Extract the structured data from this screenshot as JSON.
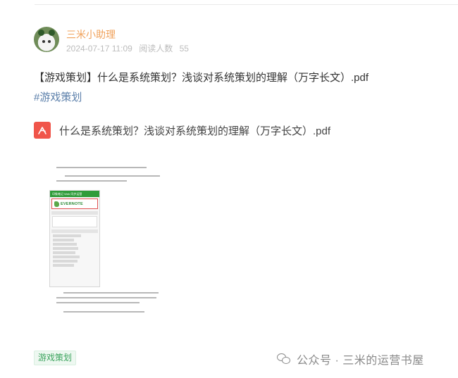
{
  "post": {
    "author": "三米小助理",
    "date": "2024-07-17 11:09",
    "read_label": "阅读人数",
    "read_count": "55",
    "title": "【游戏策划】什么是系统策划？浅谈对系统策划的理解（万字长文）.pdf",
    "hashtag": "#游戏策划",
    "attachment": {
      "icon": "pdf-icon",
      "name": "什么是系统策划？浅谈对系统策划的理解（万字长文）.pdf"
    },
    "preview": {
      "screenshot_header": "印象笔记 Web 同步运营",
      "screenshot_logo": "EVERNOTE"
    },
    "tag": "游戏策划"
  },
  "watermark": {
    "icon": "wechat-icon",
    "text": "公众号 · 三米的运营书屋"
  },
  "colors": {
    "author": "#f0a15a",
    "hashtag": "#5b7faa",
    "pdf_icon": "#f0554a",
    "tag_text": "#3aa35c",
    "tag_bg": "#eef8f1"
  }
}
